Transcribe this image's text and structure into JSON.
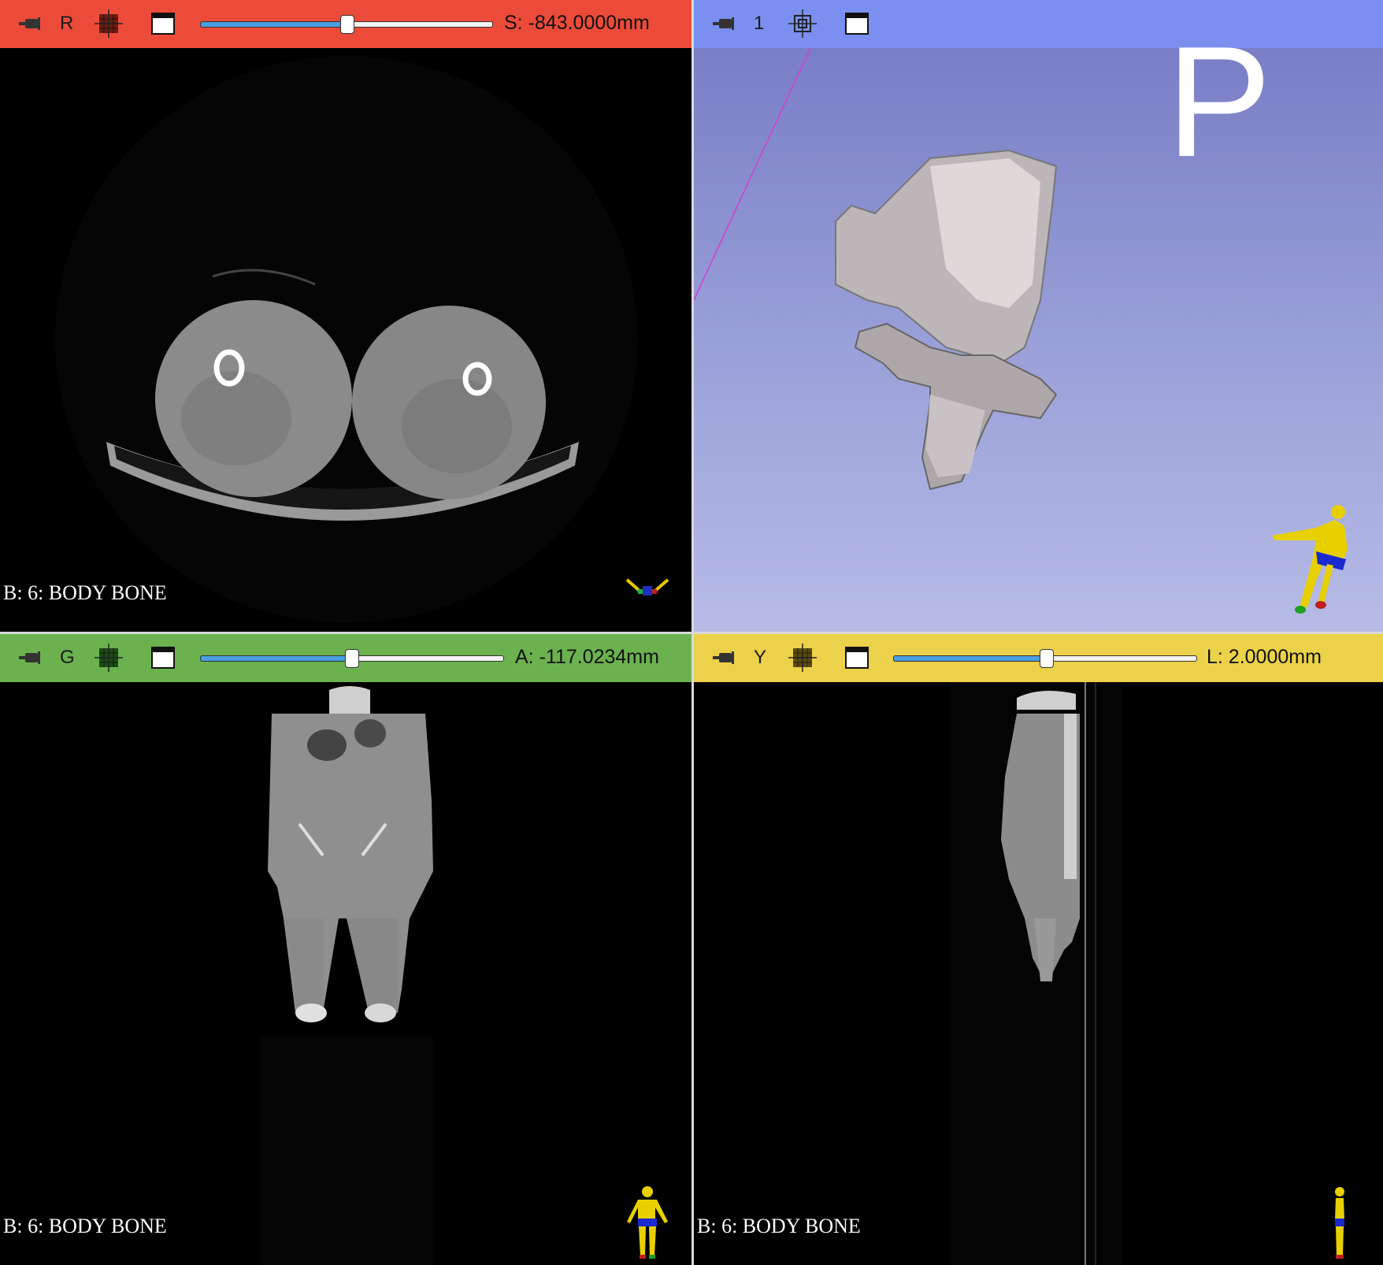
{
  "views": {
    "red": {
      "bar_color": "#ec4b3a",
      "letter": "R",
      "offset_text": "S: -843.0000mm",
      "slider_position": 0.5,
      "volume_label": "B: 6: BODY BONE"
    },
    "three_d": {
      "bar_color": "#7a8ff0",
      "view_number": "1",
      "orientation_letter": "P"
    },
    "green": {
      "bar_color": "#6bb24f",
      "letter": "G",
      "offset_text": "A: -117.0234mm",
      "slider_position": 0.52,
      "volume_label": "B: 6: BODY BONE"
    },
    "yellow": {
      "bar_color": "#ecd14a",
      "letter": "Y",
      "offset_text": "L: 2.0000mm",
      "slider_position": 0.5,
      "volume_label": "B: 6: BODY BONE"
    }
  },
  "icons": {
    "pin": "pin-icon",
    "grid": "slice-grid-icon",
    "window": "maximize-view-icon",
    "crosshair": "center-view-icon"
  }
}
